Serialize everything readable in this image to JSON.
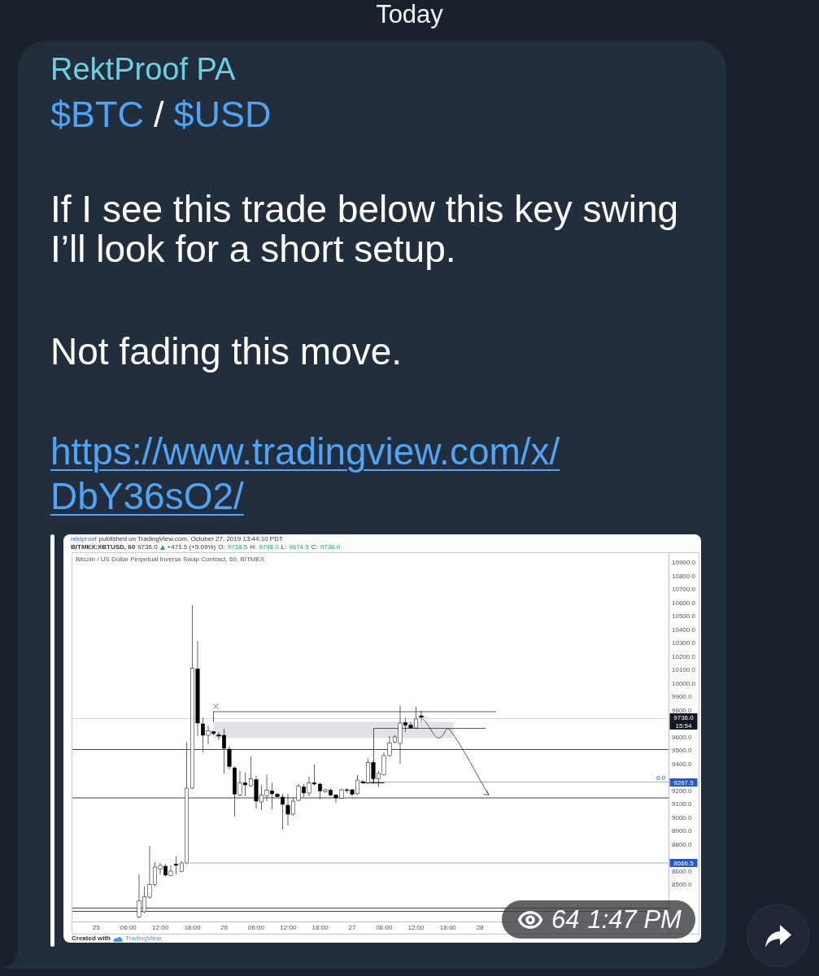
{
  "date_header": "Today",
  "message": {
    "author": "RektProof PA",
    "pair": {
      "base": "$BTC",
      "separator": "/",
      "quote": "$USD"
    },
    "paragraphs": [
      "If I see this trade below this key swing I’ll look for a short setup.",
      "Not fading this move."
    ],
    "link": {
      "lines": [
        "https://www.tradingview.com/x/",
        "DbY36sO2/"
      ]
    },
    "chart_image": {
      "publisher": {
        "user": "rektproof",
        "text": "published on TradingView.com, October 27, 2019 13:44:10 PDT"
      },
      "symbol_line": {
        "symbol": "BITMEX:XBTUSD, 60",
        "price": "9736.0",
        "change": "+471.5 (+5.09%)",
        "ohlc": [
          {
            "label": "O:",
            "value": "9738.5"
          },
          {
            "label": "H:",
            "value": "9798.0"
          },
          {
            "label": "L:",
            "value": "9674.5"
          },
          {
            "label": "C:",
            "value": "9736.0"
          }
        ]
      },
      "title": "Bitcoin / US Dollar Perpetual Inverse Swap Contract, 60, BITMEX",
      "y_axis_labels": [
        "10900.0",
        "10800.0",
        "10700.0",
        "10600.0",
        "10500.0",
        "10400.0",
        "10300.0",
        "10200.0",
        "10100.0",
        "10000.0",
        "9900.0",
        "9800.0",
        "9600.0",
        "9500.0",
        "9400.0",
        "9200.0",
        "9100.0",
        "9000.0",
        "8900.0",
        "8800.0",
        "8600.0",
        "8500.0"
      ],
      "price_tags": [
        {
          "text": "9736.0",
          "color": "#131722"
        },
        {
          "text": "15:54",
          "color": "#131722"
        },
        {
          "text": "9267.5",
          "color": "#2457d6"
        },
        {
          "text": "8666.5",
          "color": "#2457d6"
        }
      ],
      "fib_label": "0.0",
      "x_axis_labels": [
        "25",
        "06:00",
        "12:00",
        "18:00",
        "26",
        "06:00",
        "12:00",
        "18:00",
        "27",
        "06:00",
        "12:00",
        "18:00",
        "28"
      ],
      "footer": {
        "text": "Created with",
        "brand": "TradingView"
      }
    },
    "views": "64",
    "time": "1:47 PM"
  }
}
